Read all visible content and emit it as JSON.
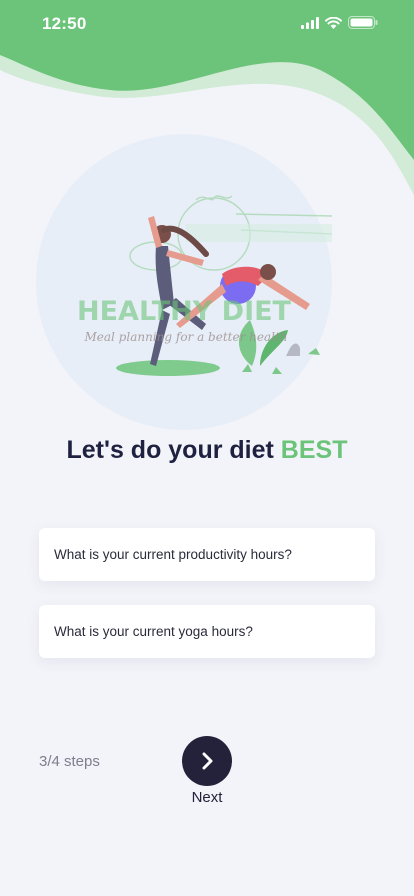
{
  "status_bar": {
    "time": "12:50",
    "icons": [
      "signal-icon",
      "wifi-icon",
      "battery-icon"
    ]
  },
  "hero": {
    "watermark_title": "HEALTHY DIET",
    "watermark_subtitle": "Meal planning for a better health"
  },
  "headline": {
    "text": "Let's do your diet ",
    "accent": "BEST"
  },
  "questions": [
    {
      "label": "What is your current productivity hours?"
    },
    {
      "label": "What is your current yoga hours?"
    }
  ],
  "footer": {
    "steps": "3/4 steps",
    "next_label": "Next",
    "next_icon": "chevron-right-icon"
  },
  "colors": {
    "brand_green": "#6cc47a",
    "dark": "#23223a",
    "background": "#f3f4f9"
  }
}
